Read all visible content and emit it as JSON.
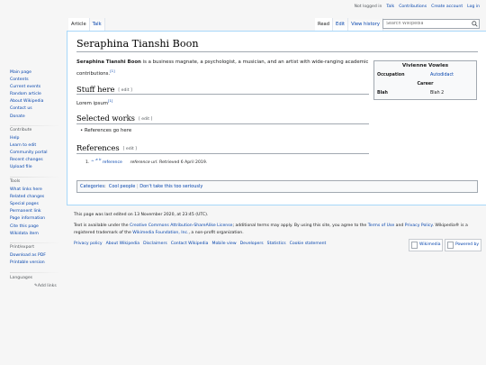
{
  "personal": {
    "not_logged": "Not logged in",
    "talk": "Talk",
    "contributions": "Contributions",
    "create_account": "Create account",
    "login": "Log in"
  },
  "tabs": {
    "article": "Article",
    "talk": "Talk",
    "read": "Read",
    "edit": "Edit",
    "view_history": "View history"
  },
  "search": {
    "placeholder": "Search Wikipedia"
  },
  "sidebar": {
    "nav": [
      "Main page",
      "Contents",
      "Current events",
      "Random article",
      "About Wikipedia",
      "Contact us",
      "Donate"
    ],
    "contribute_heading": "Contribute",
    "contribute": [
      "Help",
      "Learn to edit",
      "Community portal",
      "Recent changes",
      "Upload file"
    ],
    "tools_heading": "Tools",
    "tools": [
      "What links here",
      "Related changes",
      "Special pages",
      "Permanent link",
      "Page information",
      "Cite this page",
      "Wikidata item"
    ],
    "print_heading": "Print/export",
    "print": [
      "Download as PDF",
      "Printable version"
    ],
    "languages_heading": "Languages",
    "add_links": "Add links"
  },
  "article": {
    "title": "Seraphina Tianshi Boon",
    "lead_bold": "Seraphina Tianshi Boon",
    "lead_rest": " is a business magnate, a psychologist, a musician, and an artist with wide-ranging academic",
    "lead_line2": "contributions.",
    "lead_ref": "[1]",
    "s1_heading": "Stuff here",
    "s1_text": "Lorem ipsum",
    "s1_ref": "[1]",
    "s2_heading": "Selected works",
    "s2_item": "References go here",
    "s3_heading": "References",
    "edit_label": "[ edit ]",
    "ref_num": "1.",
    "ref_caret": "^",
    "ref_a": "a",
    "ref_b": "b",
    "ref_link": "reference",
    "ref_url": "reference url",
    "ref_retrieved": ". Retrieved 6 April 2019."
  },
  "infobox": {
    "title": "Vivienne Vowles",
    "row1_label": "Occupation",
    "row1_value": "Autodidact",
    "section": "Career",
    "row2_label": "Blah",
    "row2_value": "Blah 2"
  },
  "categories": {
    "label": "Categories",
    "items": [
      "Cool people",
      "Don't take this too seriously"
    ]
  },
  "footer": {
    "last_edited": "This page was last edited on 13 November 2020, at 23:45 (UTC).",
    "license_pre": "Text is available under the ",
    "license_link": "Creative Commons Attribution-ShareAlike License",
    "license_mid": "; additional terms may apply. By using this site, you agree to the ",
    "terms": "Terms of Use",
    "and": " and ",
    "privacy": "Privacy Policy",
    "license_post": ". Wikipedia® is a",
    "line3_pre": "registered trademark of the ",
    "foundation": "Wikimedia Foundation, Inc.",
    "line3_post": ", a non-profit organization.",
    "links": [
      "Privacy policy",
      "About Wikipedia",
      "Disclaimers",
      "Contact Wikipedia",
      "Mobile view",
      "Developers",
      "Statistics",
      "Cookie statement"
    ],
    "badge1": "Wikimedia",
    "badge2": "Powered by"
  }
}
